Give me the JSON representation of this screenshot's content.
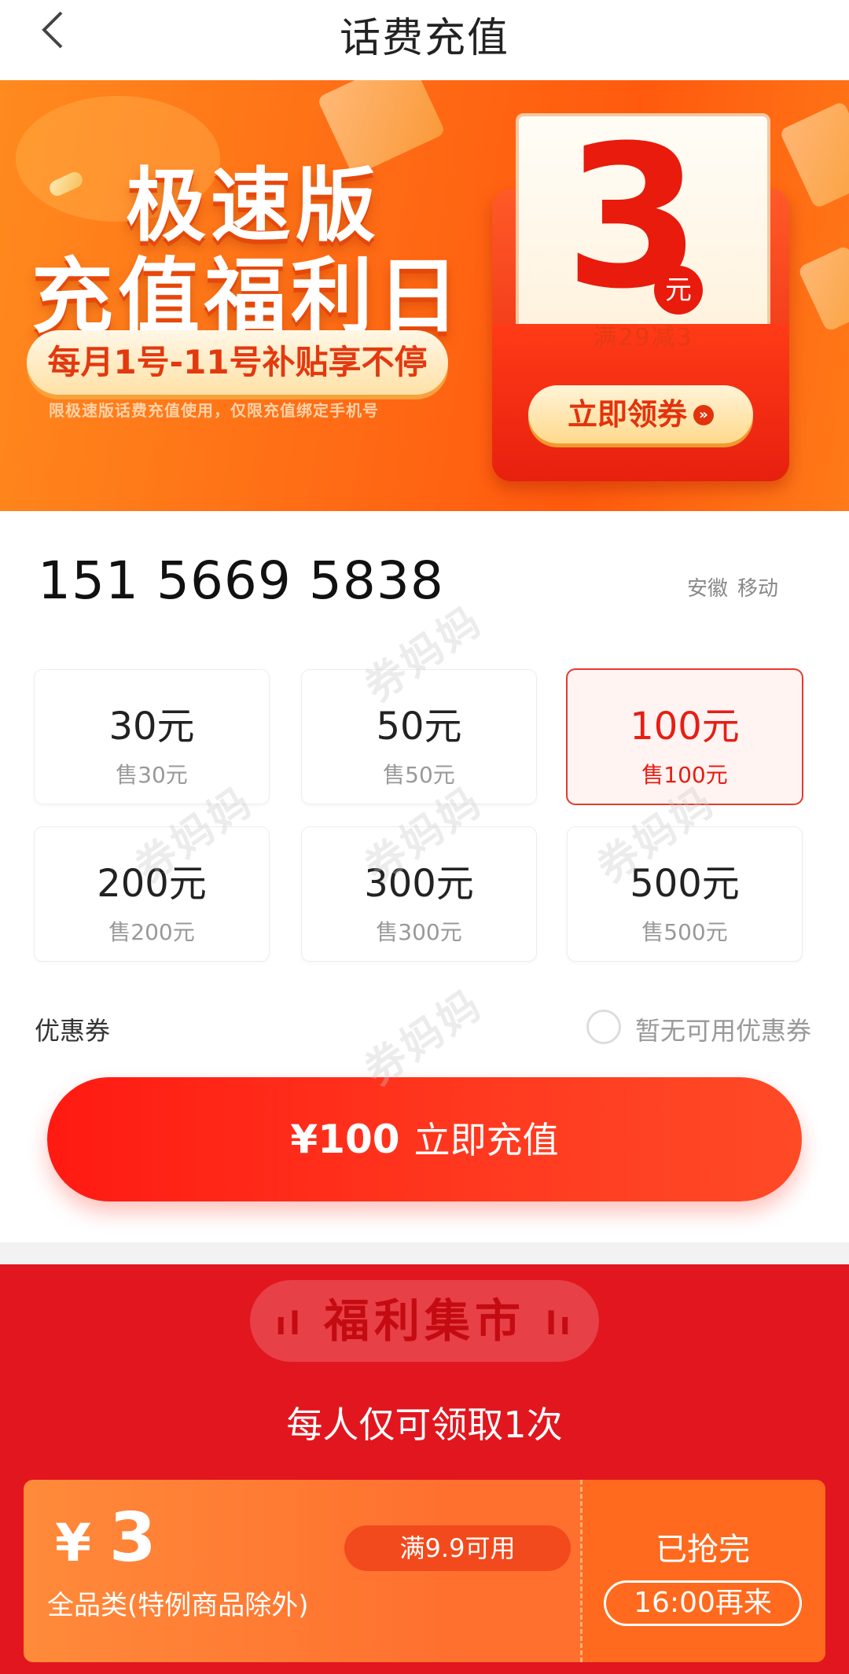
{
  "header": {
    "title": "话费充值"
  },
  "banner": {
    "line1": "极速版",
    "line2": "充值福利日",
    "pill": "每月1号-11号补贴享不停",
    "note": "限极速版话费充值使用，仅限充值绑定手机号",
    "coupon_value": "3",
    "coupon_unit": "元",
    "coupon_condition": "满29减3",
    "claim_label": "立即领券"
  },
  "account": {
    "phone": "151 5669 5838",
    "province": "安徽",
    "carrier": "移动"
  },
  "amounts": [
    {
      "face": "30元",
      "price": "售30元",
      "selected": false
    },
    {
      "face": "50元",
      "price": "售50元",
      "selected": false
    },
    {
      "face": "100元",
      "price": "售100元",
      "selected": true
    },
    {
      "face": "200元",
      "price": "售200元",
      "selected": false
    },
    {
      "face": "300元",
      "price": "售300元",
      "selected": false
    },
    {
      "face": "500元",
      "price": "售500元",
      "selected": false
    }
  ],
  "coupon": {
    "label": "优惠券",
    "status": "暂无可用优惠券"
  },
  "pay": {
    "amount": "¥100",
    "label": "立即充值"
  },
  "market": {
    "title": "福利集市",
    "subtitle": "每人仅可领取1次",
    "card": {
      "currency": "¥",
      "value": "3",
      "scope": "全品类(特例商品除外)",
      "condition": "满9.9可用",
      "status": "已抢完",
      "next_time": "16:00再来"
    }
  },
  "watermark": "券妈妈",
  "colors": {
    "accent": "#e61e14",
    "banner_orange": "#ff6a14",
    "market_red": "#e2161e"
  }
}
